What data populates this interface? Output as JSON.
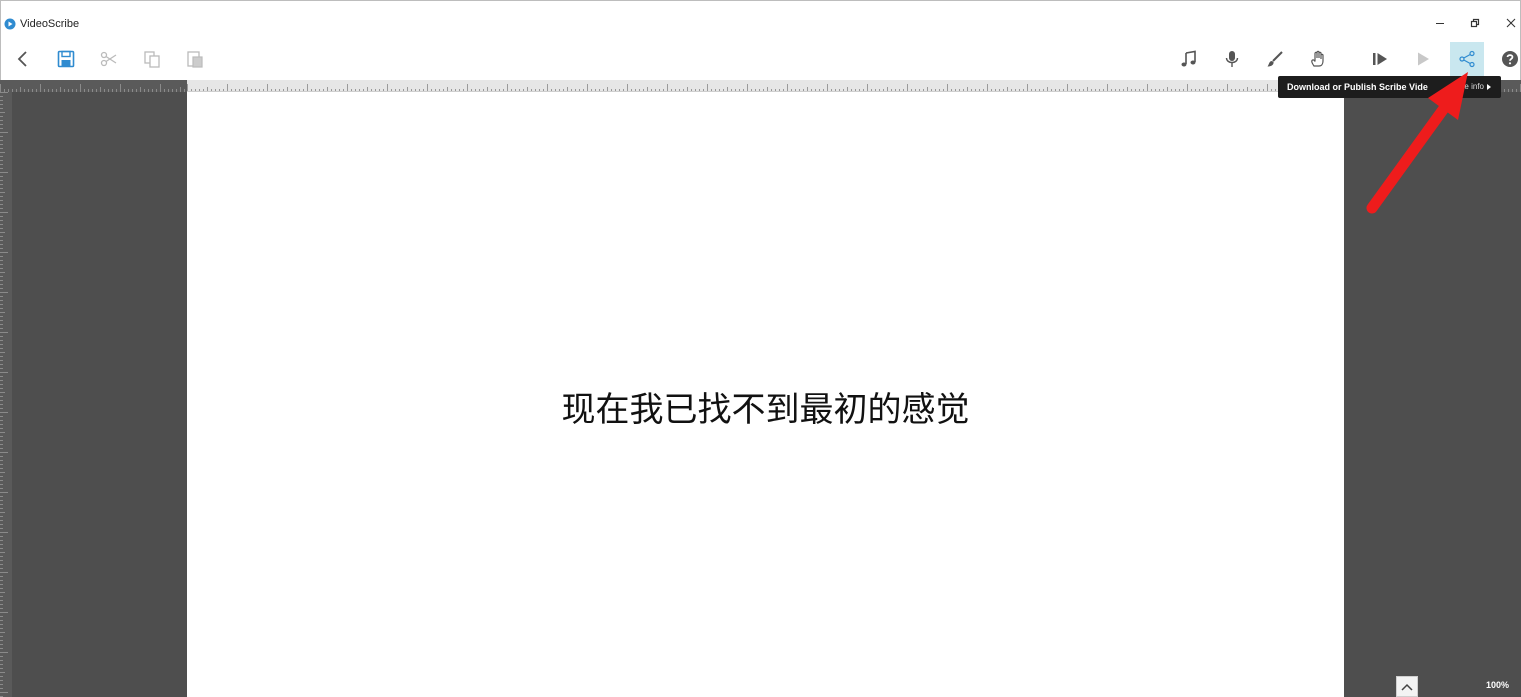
{
  "window": {
    "title": "VideoScribe",
    "app_icon": "videoscribe-logo-icon",
    "controls": [
      "minimize-icon",
      "restore-icon",
      "close-icon"
    ]
  },
  "toolbar": {
    "left_icons": [
      "back-icon",
      "save-icon",
      "cut-icon",
      "copy-icon",
      "paste-icon"
    ],
    "right_icons": [
      "music-icon",
      "microphone-icon",
      "brush-icon",
      "hand-icon",
      "play-from-start-icon",
      "play-icon",
      "share-icon",
      "help-icon"
    ]
  },
  "tooltip": {
    "text": "Download or Publish Scribe Vide",
    "more": "e info"
  },
  "canvas": {
    "text": "现在我已找不到最初的感觉"
  },
  "status": {
    "zoom": "100%"
  },
  "colors": {
    "active_button": "#c9e7ef",
    "annotation": "#ee1c1c",
    "workspace": "#4e4e4e"
  }
}
